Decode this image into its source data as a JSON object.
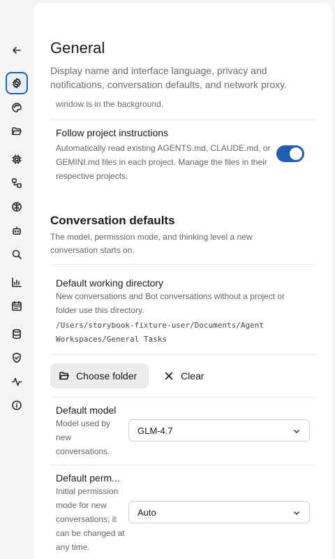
{
  "sidebar": {
    "items": [
      {
        "name": "back",
        "icon": "arrow-left-icon"
      },
      {
        "name": "general",
        "icon": "gear-icon",
        "active": true
      },
      {
        "name": "appearance",
        "icon": "palette-icon"
      },
      {
        "name": "projects",
        "icon": "folder-open-icon"
      },
      {
        "name": "models",
        "icon": "chip-icon"
      },
      {
        "name": "workflows",
        "icon": "workflow-icon"
      },
      {
        "name": "memory",
        "icon": "brain-icon"
      },
      {
        "name": "bots",
        "icon": "bot-icon"
      },
      {
        "name": "search",
        "icon": "search-icon"
      },
      {
        "name": "usage",
        "icon": "bar-chart-icon"
      },
      {
        "name": "schedule",
        "icon": "calendar-icon"
      },
      {
        "name": "data",
        "icon": "database-icon"
      },
      {
        "name": "security",
        "icon": "shield-check-icon"
      },
      {
        "name": "activity",
        "icon": "activity-icon"
      },
      {
        "name": "about",
        "icon": "info-icon"
      }
    ]
  },
  "page": {
    "title": "General",
    "subtitle": "Display name and interface language, privacy and notifications, conversation defaults, and network proxy."
  },
  "cut_off_text": "window is in the background.",
  "follow_instructions": {
    "title": "Follow project instructions",
    "description": "Automatically read existing AGENTS.md, CLAUDE.md, or GEMINI.md files in each project. Manage the files in their respective projects.",
    "enabled": true
  },
  "conversation_defaults": {
    "title": "Conversation defaults",
    "description": "The model, permission mode, and thinking level a new conversation starts on."
  },
  "working_directory": {
    "title": "Default working directory",
    "description": "New conversations and Bot conversations without a project or folder use this directory.",
    "path": "/Users/storybook-fixture-user/Documents/Agent Workspaces/General Tasks",
    "choose_label": "Choose folder",
    "clear_label": "Clear"
  },
  "default_model": {
    "title": "Default model",
    "description": "Model used by new conversations.",
    "value": "GLM-4.7"
  },
  "default_permission": {
    "title": "Default perm...",
    "description": "Initial permission mode for new conversations; it can be changed at any time.",
    "value": "Auto"
  },
  "colors": {
    "accent": "#1f5fb3",
    "panel_bg": "#ffffff",
    "app_bg": "#f4f4f4"
  }
}
